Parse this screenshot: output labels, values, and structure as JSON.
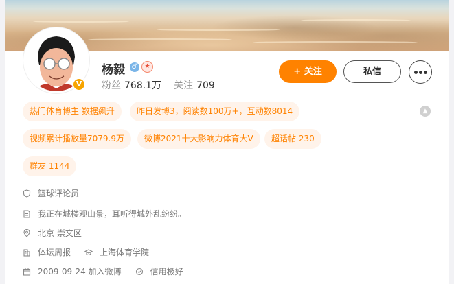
{
  "profile": {
    "name": "杨毅",
    "followers_label": "粉丝",
    "followers_value": "768.1万",
    "following_label": "关注",
    "following_value": "709",
    "verified_badge": "V"
  },
  "actions": {
    "follow_label": "+ 关注",
    "message_label": "私信",
    "more_icon": "more-dots-icon"
  },
  "tags": [
    "热门体育博主 数据飙升",
    "昨日发博3，阅读数100万+，互动数8014",
    "视频累计播放量7079.9万",
    "微博2021十大影响力体育大V",
    "超话帖 230",
    "群友 1144"
  ],
  "info": {
    "title": "篮球评论员",
    "bio": "我正在城楼观山景，耳听得城外乱纷纷。",
    "location": "北京 崇文区",
    "company": "体坛周报",
    "school": "上海体育学院",
    "joined": "2009-09-24 加入微博",
    "credit": "信用极好"
  },
  "colors": {
    "accent": "#ff8200",
    "tag_bg": "#fff3ea",
    "verified": "#f7a400",
    "gender": "#7ab5e8"
  }
}
